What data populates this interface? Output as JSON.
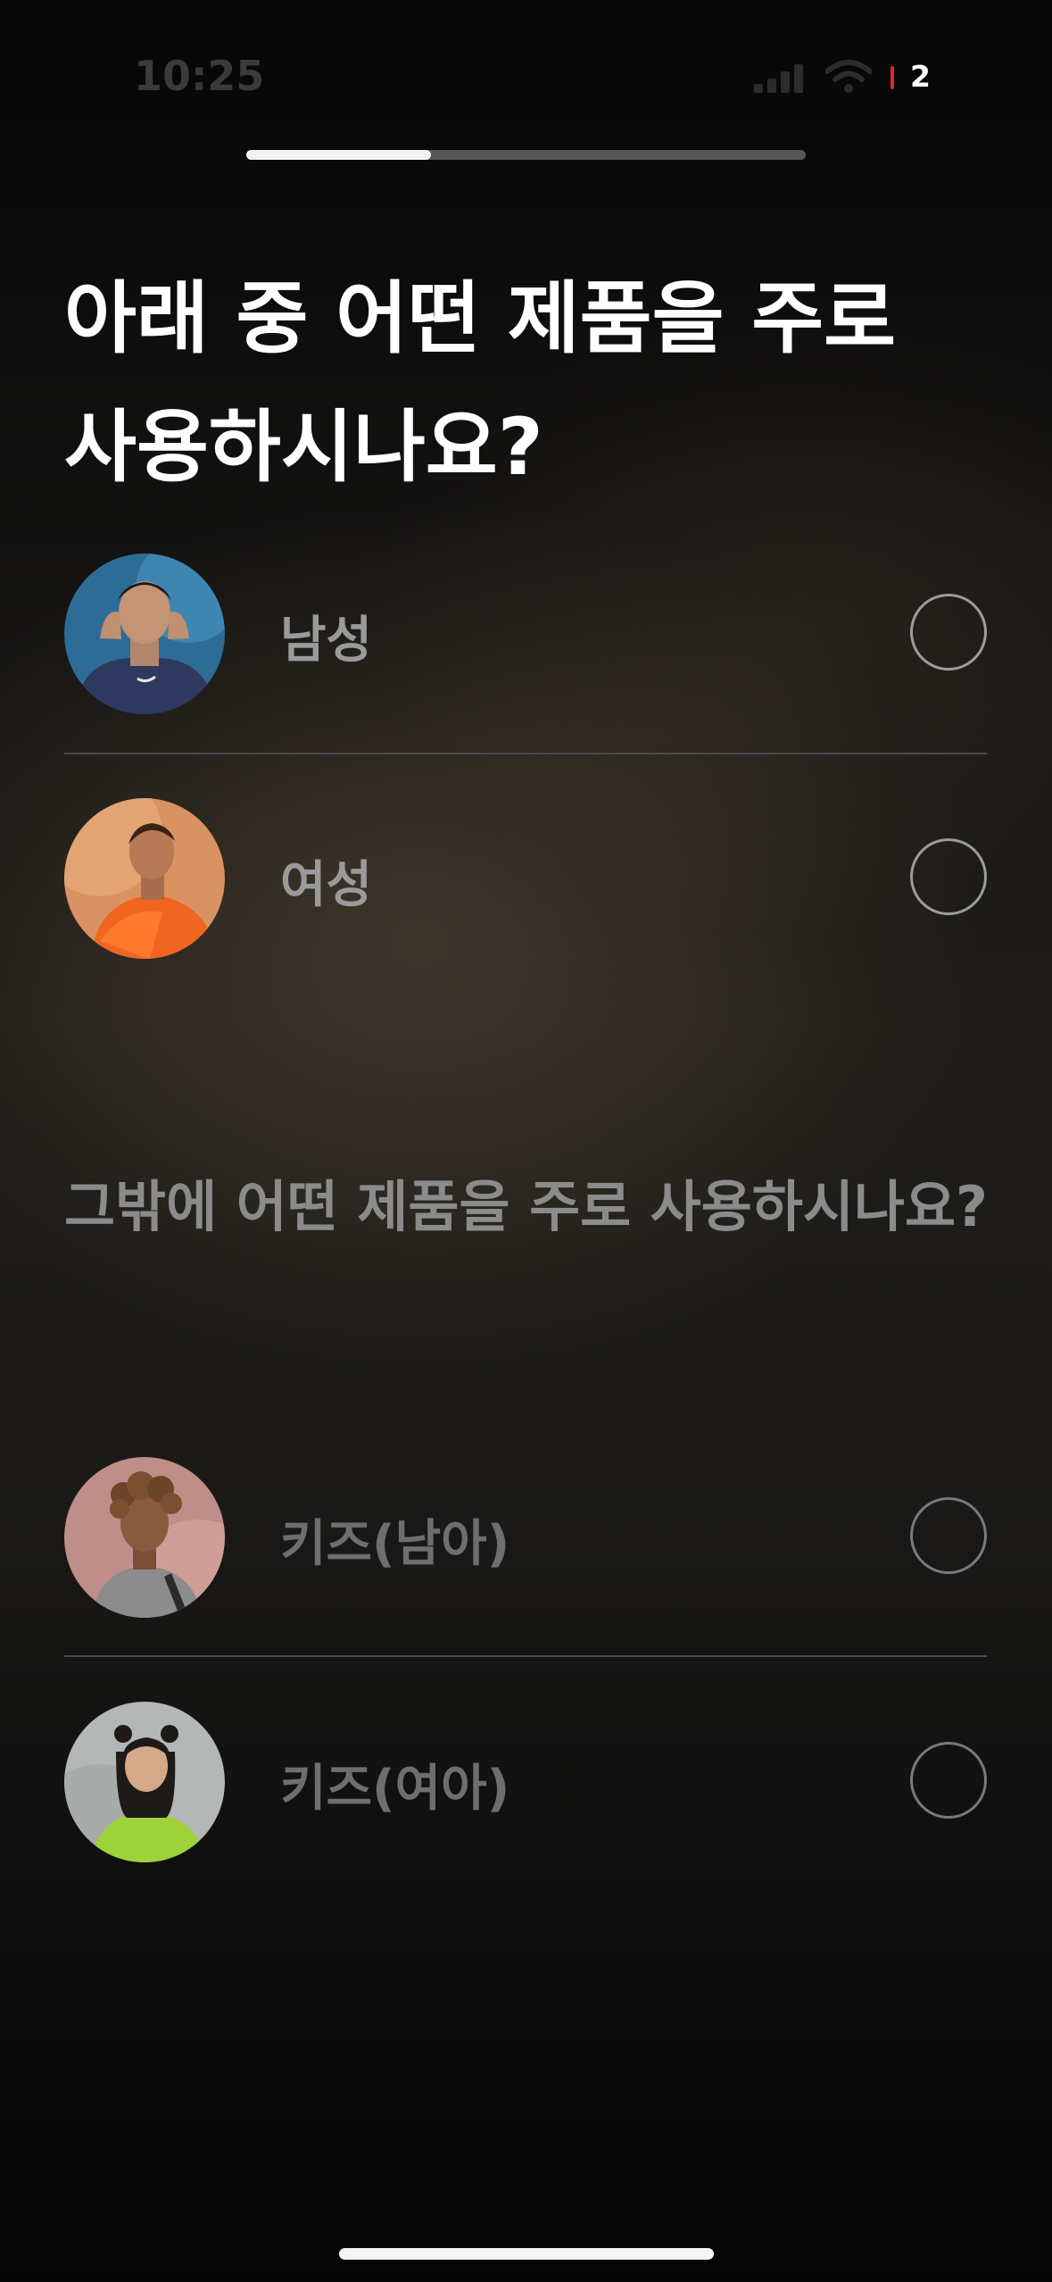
{
  "status_bar": {
    "time": "10:25",
    "battery_level": "2"
  },
  "progress": {
    "fraction": 0.33
  },
  "question": {
    "title": "아래 중 어떤 제품을 주로 사용하시나요?",
    "options": [
      {
        "label": "남성",
        "selected": false
      },
      {
        "label": "여성",
        "selected": false
      }
    ]
  },
  "secondary_question": {
    "title": "그밖에 어떤 제품을 주로 사용하시나요?",
    "options": [
      {
        "label": "키즈(남아)",
        "selected": false
      },
      {
        "label": "키즈(여아)",
        "selected": false
      }
    ]
  }
}
